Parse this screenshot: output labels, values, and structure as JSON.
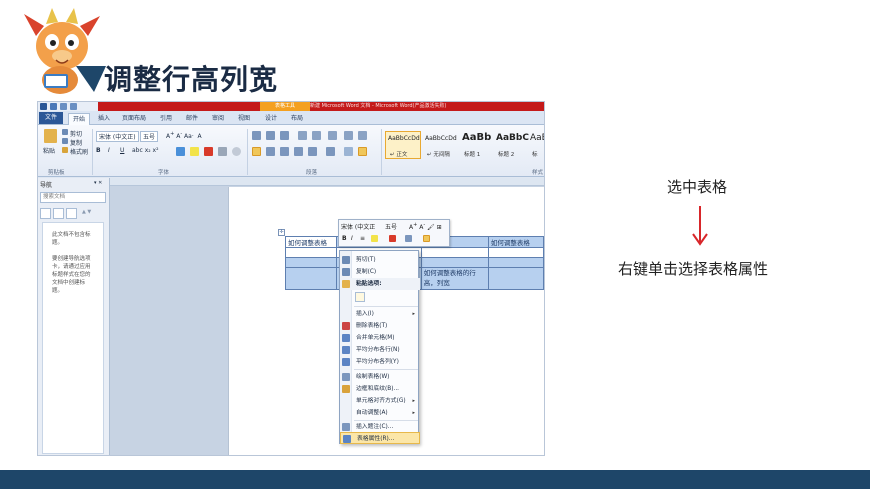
{
  "slide": {
    "title": "调整行高列宽",
    "step1": "选中表格",
    "step2": "右键单击选择表格属性",
    "accent_color": "#1e4669",
    "arrow_color": "#d8262a"
  },
  "word": {
    "contextual_tab": "表格工具",
    "window_title": "新建 Microsoft Word 文档 - Microsoft Word(产品激活失败)",
    "tabs": [
      "文件",
      "开始",
      "插入",
      "页面布局",
      "引用",
      "邮件",
      "审阅",
      "视图",
      "设计",
      "布局"
    ],
    "ribbon": {
      "paste": "粘贴",
      "cut": "剪切",
      "copy": "复制",
      "format_painter": "格式刷",
      "font_name": "宋体 (中文正)",
      "font_size": "五号",
      "group_clipboard": "剪贴板",
      "group_font": "字体",
      "group_paragraph": "段落",
      "group_styles": "样式",
      "styles": [
        {
          "sample": "AaBbCcDd",
          "name": "↵ 正文"
        },
        {
          "sample": "AaBbCcDd",
          "name": "↵ 无间隔"
        },
        {
          "sample": "AaBb",
          "name": "标题 1"
        },
        {
          "sample": "AaBbC",
          "name": "标题 2"
        },
        {
          "sample": "AaB",
          "name": "标"
        }
      ]
    },
    "nav": {
      "title": "导航",
      "search_placeholder": "搜索文档",
      "msg1": "此文档不包含标题。",
      "msg2": "要创建导航选项卡，请通过应用标题样式在您的文档中创建标题。"
    },
    "table": {
      "rows": [
        [
          "如何调整表格",
          "",
          "",
          "如何调整表格"
        ],
        [
          "",
          "",
          "",
          ""
        ],
        [
          "",
          "",
          "",
          ""
        ],
        [
          "",
          "",
          "如何调整表格的行高，列宽",
          ""
        ]
      ]
    },
    "minibar": {
      "font": "宋体 (中文正",
      "size": "五号"
    },
    "context_menu": [
      {
        "label": "剪切(T)",
        "icon": "cut-icon"
      },
      {
        "label": "复制(C)",
        "icon": "copy-icon"
      },
      {
        "label": "粘贴选项:",
        "icon": "paste-icon"
      },
      {
        "label": "插入(I)",
        "icon": "",
        "submenu": true
      },
      {
        "label": "删除表格(T)",
        "icon": "delete-table-icon"
      },
      {
        "label": "合并单元格(M)",
        "icon": "merge-cells-icon"
      },
      {
        "label": "平均分布各行(N)",
        "icon": "distribute-rows-icon"
      },
      {
        "label": "平均分布各列(Y)",
        "icon": "distribute-columns-icon"
      },
      {
        "label": "绘制表格(W)",
        "icon": "draw-table-icon"
      },
      {
        "label": "边框和底纹(B)...",
        "icon": "borders-icon"
      },
      {
        "label": "单元格对齐方式(G)",
        "icon": "",
        "submenu": true
      },
      {
        "label": "自动调整(A)",
        "icon": "",
        "submenu": true
      },
      {
        "label": "插入题注(C)...",
        "icon": "caption-icon"
      },
      {
        "label": "表格属性(R)...",
        "icon": "table-properties-icon"
      }
    ]
  }
}
